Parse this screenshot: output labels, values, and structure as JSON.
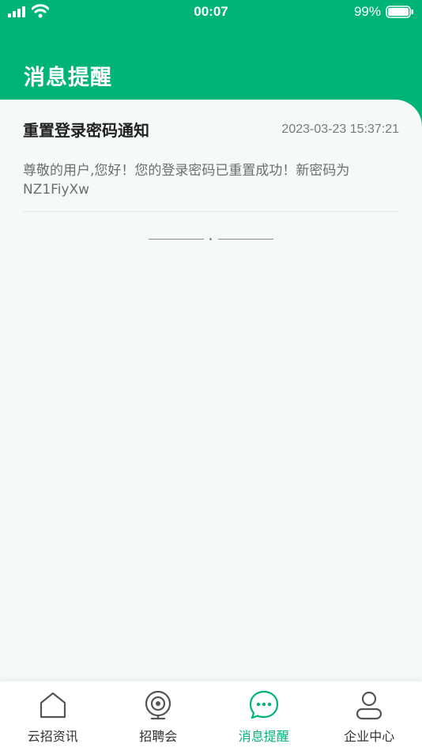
{
  "status_bar": {
    "time": "00:07",
    "battery_pct": "99%"
  },
  "header": {
    "title": "消息提醒"
  },
  "messages": [
    {
      "title": "重置登录密码通知",
      "time": "2023-03-23 15:37:21",
      "body": "尊敬的用户,您好！您的登录密码已重置成功！新密码为NZ1FiyXw"
    }
  ],
  "tab_bar": {
    "tabs": [
      {
        "label": "云招资讯",
        "icon": "home-icon",
        "active": false
      },
      {
        "label": "招聘会",
        "icon": "camera-icon",
        "active": false
      },
      {
        "label": "消息提醒",
        "icon": "chat-icon",
        "active": true
      },
      {
        "label": "企业中心",
        "icon": "person-icon",
        "active": false
      }
    ]
  },
  "colors": {
    "primary": "#00b377",
    "background": "#f5f9f8"
  }
}
